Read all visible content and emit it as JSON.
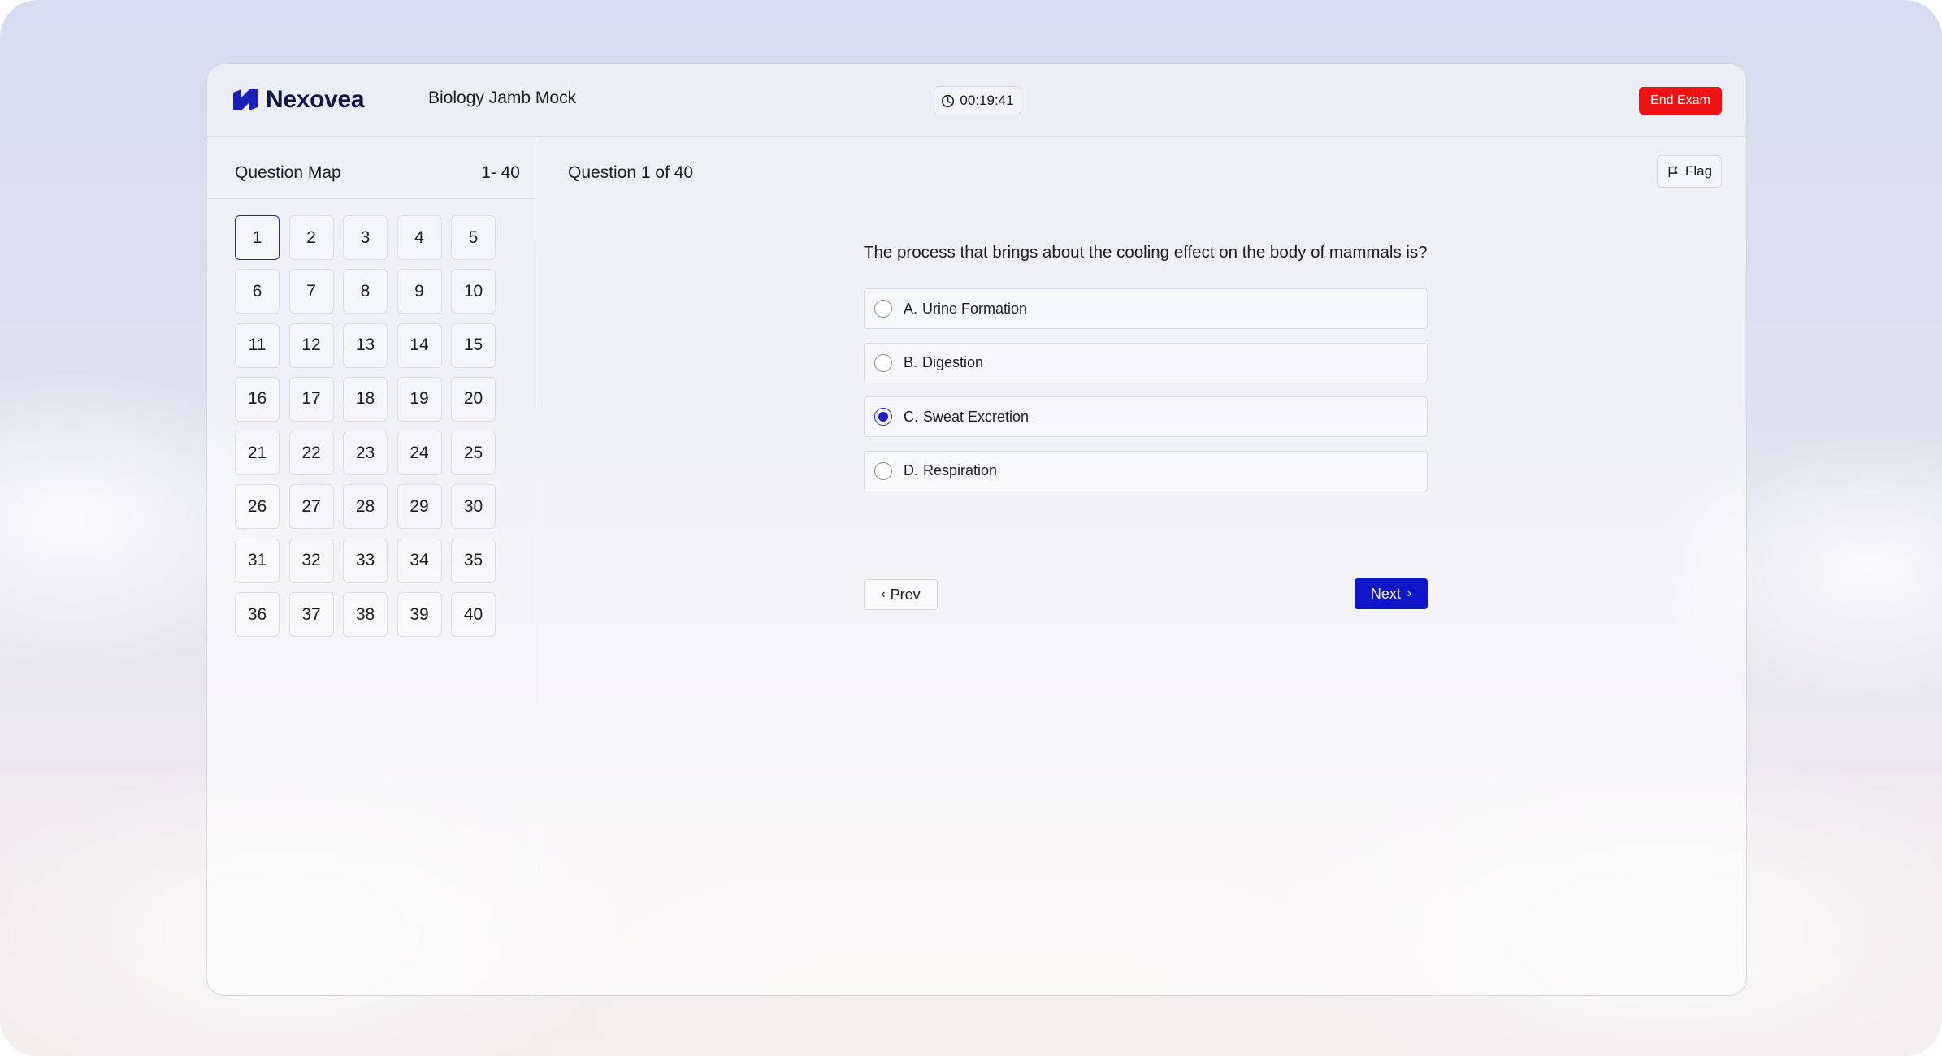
{
  "app": {
    "brand": "Nexovea",
    "exam_title": "Biology Jamb Mock",
    "timer": "00:19:41",
    "end_exam_label": "End Exam",
    "accent_color": "#0d16c9",
    "danger_color": "#ee1313"
  },
  "sidebar": {
    "title": "Question Map",
    "range": "1- 40",
    "current": 1,
    "numbers": [
      "1",
      "2",
      "3",
      "4",
      "5",
      "6",
      "7",
      "8",
      "9",
      "10",
      "11",
      "12",
      "13",
      "14",
      "15",
      "16",
      "17",
      "18",
      "19",
      "20",
      "21",
      "22",
      "23",
      "24",
      "25",
      "26",
      "27",
      "28",
      "29",
      "30",
      "31",
      "32",
      "33",
      "34",
      "35",
      "36",
      "37",
      "38",
      "39",
      "40"
    ]
  },
  "main": {
    "counter": "Question 1 of 40",
    "flag_label": "Flag",
    "question": "The process that brings about the cooling effect on the body of mammals is?",
    "options": [
      {
        "letter": "A.",
        "text": "Urine Formation",
        "selected": false
      },
      {
        "letter": "B.",
        "text": "Digestion",
        "selected": false
      },
      {
        "letter": "C.",
        "text": "Sweat Excretion",
        "selected": true
      },
      {
        "letter": "D.",
        "text": "Respiration",
        "selected": false
      }
    ],
    "prev_label": "Prev",
    "next_label": "Next"
  },
  "icons": {
    "logo": "nexovea-logo-icon",
    "timer": "clock-icon",
    "flag": "flag-icon",
    "prev": "chevron-left-icon",
    "next": "chevron-right-icon"
  }
}
